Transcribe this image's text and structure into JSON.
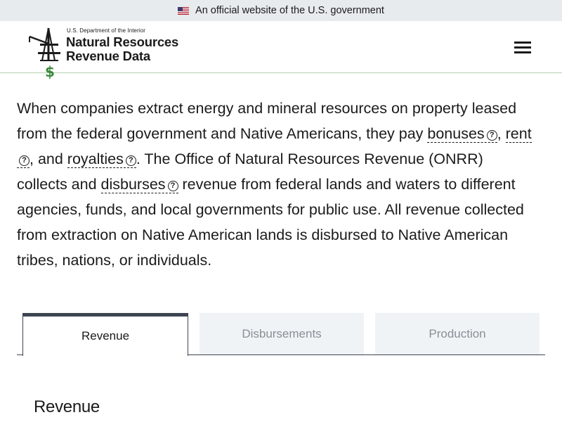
{
  "banner": {
    "text": "An official website of the U.S. government",
    "flag_icon": "us-flag-icon"
  },
  "logo": {
    "dept": "U.S. Department of the Interior",
    "title_line1": "Natural Resources",
    "title_line2": "Revenue Data",
    "dollar": "$"
  },
  "header": {
    "menu_icon": "hamburger-menu-icon"
  },
  "intro": {
    "p1": "When companies extract energy and mineral resources on property leased from the federal government and Native Americans, they pay ",
    "term_bonuses": "bonuses",
    "sep1": ", ",
    "term_rent": "rent",
    "sep2": ", and ",
    "term_royalties": "royalties",
    "p2": ". The Office of Natural Resources Revenue (ONRR) collects and ",
    "term_disburses": "disburses",
    "p3": " revenue from federal lands and waters to different agencies, funds, and local governments for public use. All revenue collected from extraction on Native American lands is disbursed to Native American tribes, nations, or individuals.",
    "help_glyph": "?"
  },
  "tabs": [
    {
      "label": "Revenue",
      "active": true
    },
    {
      "label": "Disbursements",
      "active": false
    },
    {
      "label": "Production",
      "active": false
    }
  ],
  "section": {
    "title": "Revenue"
  },
  "colors": {
    "banner_bg": "#e8ebee",
    "header_border": "#b5d2b0",
    "tab_border": "#3d4551",
    "inactive_tab_bg": "#f0f3f6",
    "dollar_green": "#3a8a3a"
  }
}
